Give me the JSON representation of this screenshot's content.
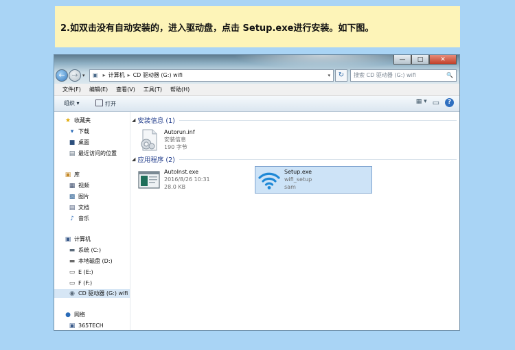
{
  "instruction": "2.如双击没有自动安装的，进入驱动盘，点击 Setup.exe进行安装。如下图。",
  "window": {
    "buttons": {
      "minimize": "—",
      "maximize": "□",
      "close": "✕"
    },
    "nav": {
      "back": "←",
      "forward": "→",
      "dropdown": "▾"
    },
    "address": {
      "parts": [
        "计算机",
        "CD 驱动器 (G:) wifi"
      ],
      "separator": "▸",
      "dropdown": "▾"
    },
    "refresh": "↻",
    "search": {
      "placeholder": "搜索 CD 驱动器 (G:) wifi",
      "icon": "🔍"
    }
  },
  "menubar": [
    "文件(F)",
    "编辑(E)",
    "查看(V)",
    "工具(T)",
    "帮助(H)"
  ],
  "cmdbar": {
    "organize": "组织 ▾",
    "open": "打开",
    "view": "▦ ▾",
    "preview": "▭",
    "help": "?"
  },
  "navpane": {
    "items": [
      {
        "label": "收藏夹",
        "icon": "★"
      },
      {
        "label": "下载",
        "icon": "▾"
      },
      {
        "label": "桌面",
        "icon": "■"
      },
      {
        "label": "最近访问的位置",
        "icon": "▤"
      },
      {
        "label": "库",
        "icon": "▣"
      },
      {
        "label": "视频",
        "icon": "▦"
      },
      {
        "label": "图片",
        "icon": "▩"
      },
      {
        "label": "文档",
        "icon": "▤"
      },
      {
        "label": "音乐",
        "icon": "♪"
      },
      {
        "label": "计算机",
        "icon": "▣"
      },
      {
        "label": "系统 (C:)",
        "icon": "▬"
      },
      {
        "label": "本地磁盘 (D:)",
        "icon": "▬"
      },
      {
        "label": "E (E:)",
        "icon": "▭"
      },
      {
        "label": "F (F:)",
        "icon": "▭"
      },
      {
        "label": "CD 驱动器 (G:) wifi",
        "icon": "◉"
      },
      {
        "label": "网络",
        "icon": "●"
      },
      {
        "label": "365TECH",
        "icon": "▣"
      }
    ]
  },
  "content": {
    "groups": [
      {
        "title": "安装信息 (1)",
        "triangle": "◢"
      },
      {
        "title": "应用程序 (2)",
        "triangle": "◢"
      }
    ],
    "files": [
      {
        "name": "Autorun.inf",
        "line2": "安装信息",
        "line3": "190 字节"
      },
      {
        "name": "AutoInst.exe",
        "line2": "2016/8/26 10:31",
        "line3": "28.0 KB"
      },
      {
        "name": "Setup.exe",
        "line2": "wifi_setup",
        "line3": "sam"
      }
    ]
  },
  "colors": {
    "background": "#a9d4f5",
    "banner": "#fdf4b8",
    "selection": "#cde3f7",
    "group_title": "#1e3a8a"
  }
}
